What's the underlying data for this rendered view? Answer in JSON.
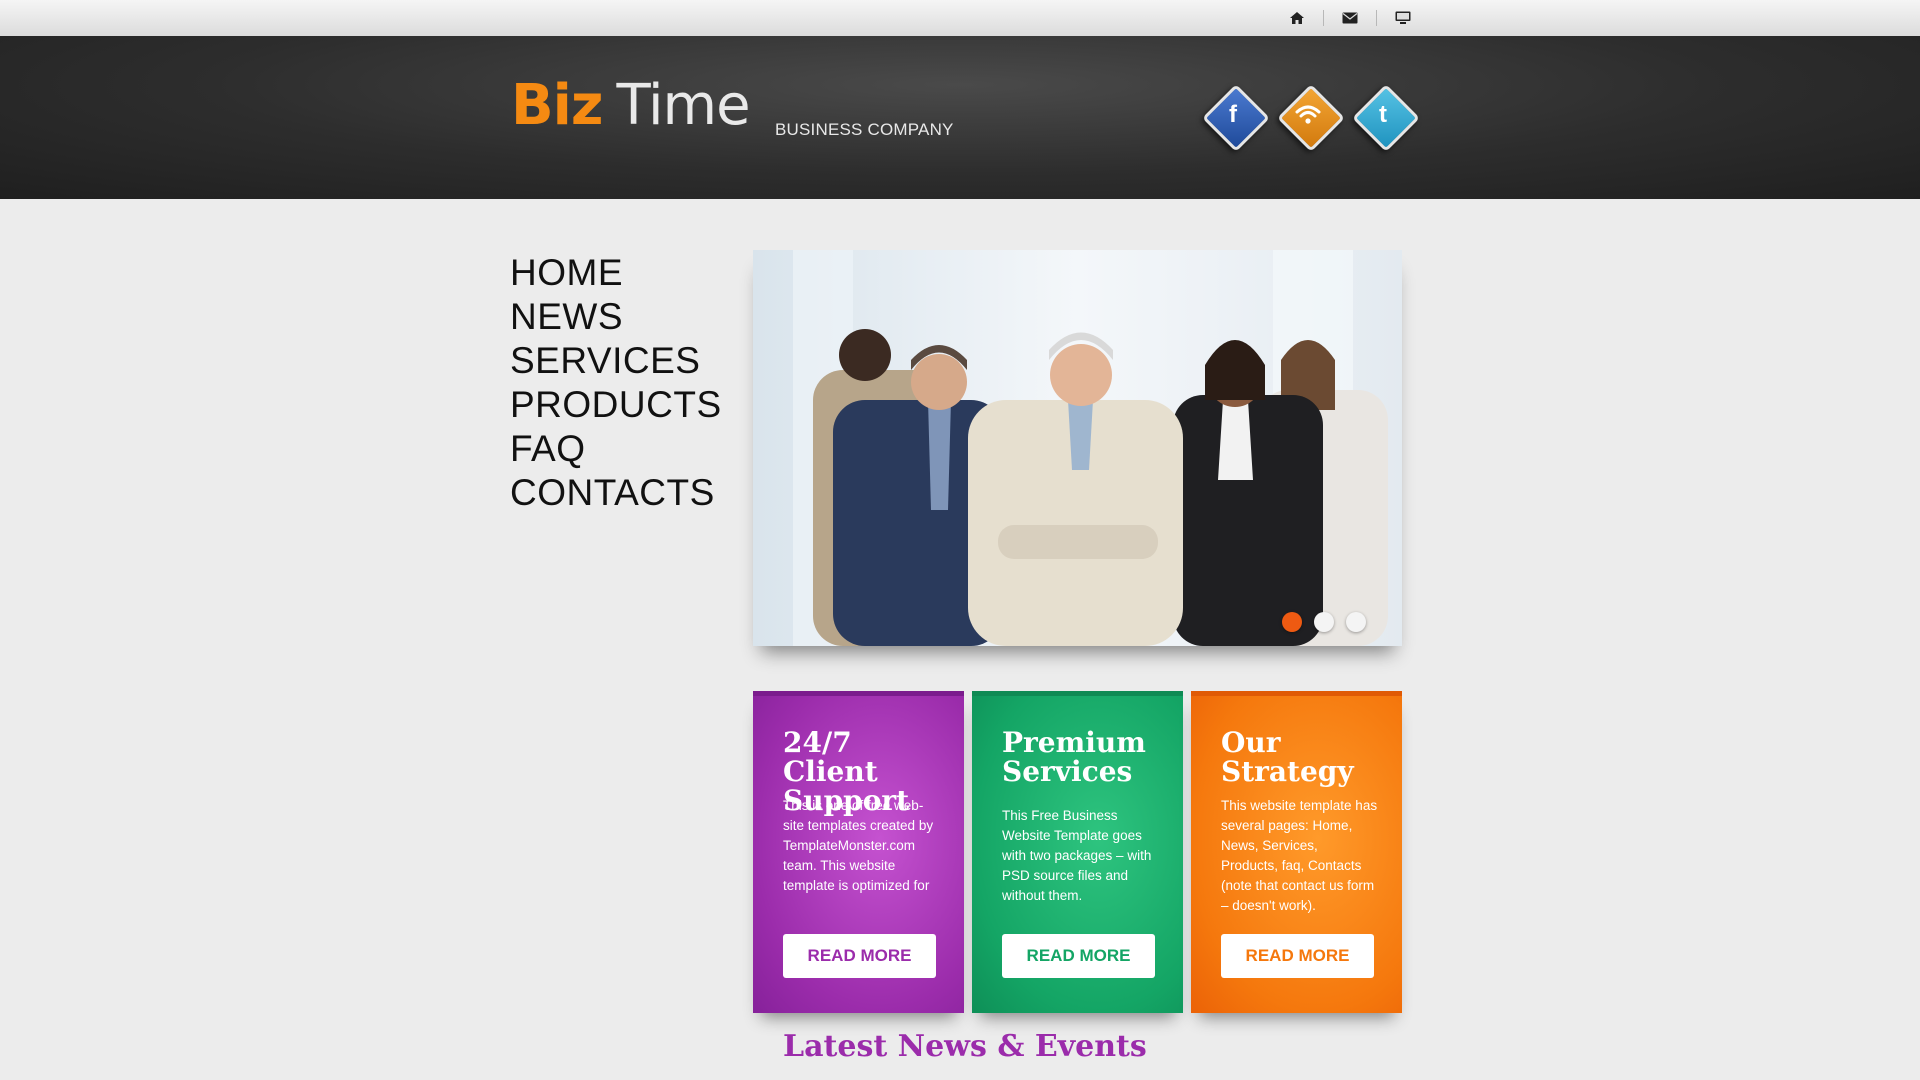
{
  "topbar": {
    "icons": [
      "home-icon",
      "mail-icon",
      "monitor-icon"
    ]
  },
  "header": {
    "logo_part1": "Biz",
    "logo_part2": "Time",
    "tagline": "BUSINESS COMPANY",
    "social": [
      {
        "name": "facebook-icon",
        "glyph": "f",
        "color": "#2b57a8"
      },
      {
        "name": "rss-icon",
        "glyph": "◠",
        "color": "#e08a14"
      },
      {
        "name": "twitter-icon",
        "glyph": "t",
        "color": "#2aa4cc"
      }
    ]
  },
  "nav": [
    "HOME",
    "NEWS",
    "SERVICES",
    "PRODUCTS",
    "FAQ",
    "CONTACTS"
  ],
  "slider": {
    "slides": 3,
    "active": 1
  },
  "boxes": [
    {
      "title_line1": "24/7 Client",
      "title_line2": "Support",
      "text": "This is one of free web-site templates created by TemplateMonster.com team. This website template is optimized for",
      "button": "READ MORE",
      "color": "#9b2cab"
    },
    {
      "title_line1": "Premium",
      "title_line2": "Services",
      "text": "This Free Business Website Template goes with two packages – with PSD source files and without them.",
      "button": "READ MORE",
      "color": "#14a565"
    },
    {
      "title_line1": "Our",
      "title_line2": "Strategy",
      "text": "This website template has several pages: Home, News, Services, Products, faq, Contacts (note that contact us form – doesn't work).",
      "button": "READ MORE",
      "color": "#f5780d"
    }
  ],
  "latest_heading": "Latest News & Events"
}
